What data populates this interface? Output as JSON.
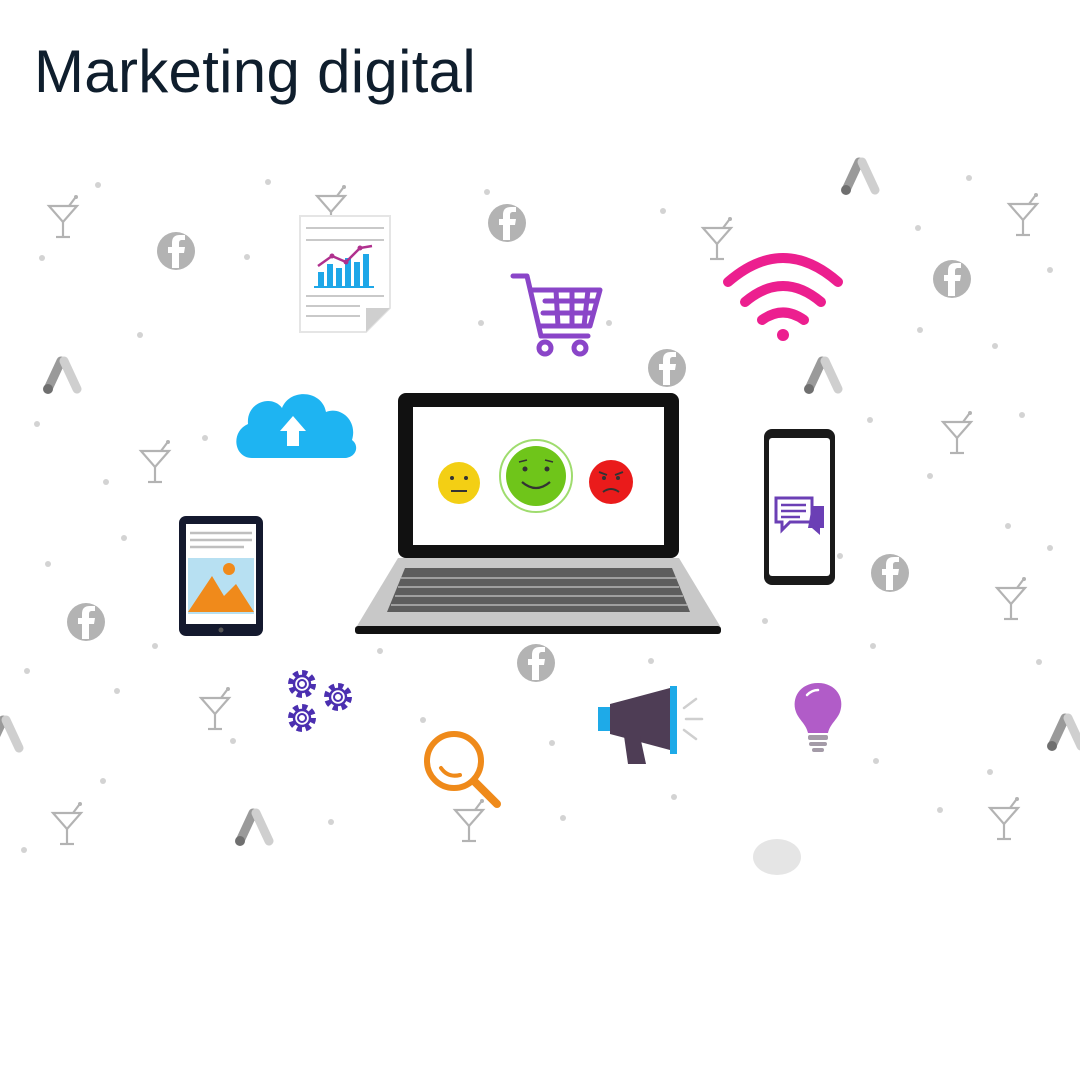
{
  "page": {
    "title": "Marketing digital"
  },
  "illustration": {
    "background_pattern_icons": [
      "facebook-icon",
      "martini-glass-icon",
      "google-ads-icon",
      "dot"
    ],
    "foreground_icons": [
      "report-chart-icon",
      "shopping-cart-icon",
      "wifi-icon",
      "cloud-upload-icon",
      "laptop-icon",
      "smartphone-chat-icon",
      "tablet-image-icon",
      "gears-icon",
      "search-icon",
      "megaphone-icon",
      "lightbulb-icon"
    ],
    "laptop_screen_faces": [
      "neutral-face-icon",
      "happy-face-icon",
      "angry-face-icon"
    ]
  },
  "colors": {
    "title_text": "#0f1e2d",
    "pattern_gray": "#b3b3b3",
    "cloud_blue": "#1eb4f2",
    "cart_purple": "#8a45c8",
    "wifi_pink": "#ec1f8f",
    "chart_blue": "#1ea7e8",
    "search_orange": "#ef8a1a",
    "bulb_purple": "#b15cc8",
    "megaphone_dark": "#4e3d55",
    "face_yellow": "#f3cf14",
    "face_green": "#6fc51a",
    "face_red": "#ea1b1b"
  }
}
